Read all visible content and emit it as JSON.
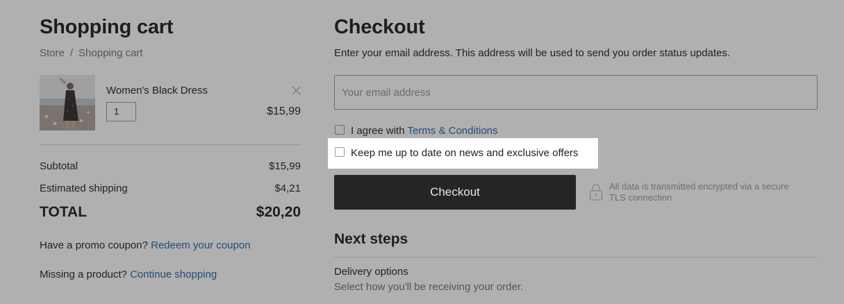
{
  "cart": {
    "title": "Shopping cart",
    "breadcrumb": {
      "store": "Store",
      "separator": "/",
      "current": "Shopping cart"
    },
    "item": {
      "name": "Women's Black Dress",
      "quantity": "1",
      "price": "$15,99"
    },
    "summary": {
      "subtotal_label": "Subtotal",
      "subtotal_value": "$15,99",
      "shipping_label": "Estimated shipping",
      "shipping_value": "$4,21",
      "total_label": "TOTAL",
      "total_value": "$20,20"
    },
    "promo": {
      "text": "Have a promo coupon?",
      "link": "Redeem your coupon"
    },
    "missing": {
      "text": "Missing a product?",
      "link": "Continue shopping"
    }
  },
  "checkout": {
    "title": "Checkout",
    "instructions": "Enter your email address. This address will be used to send you order status updates.",
    "email_placeholder": "Your email address",
    "terms": {
      "text": "I agree with",
      "link": "Terms & Conditions"
    },
    "newsletter_label": "Keep me up to date on news and exclusive offers",
    "button_label": "Checkout",
    "secure_line1": "All data is transmitted encrypted via a secure",
    "secure_line2": "TLS connection"
  },
  "next_steps": {
    "title": "Next steps",
    "delivery_title": "Delivery options",
    "delivery_desc": "Select how you'll be receiving your order."
  },
  "icons": {
    "remove": "close-icon",
    "secure": "lock-icon"
  },
  "colors": {
    "overlay": "#b0b0b0",
    "link": "#234c77",
    "button": "#252525",
    "highlight": "#ffffff"
  }
}
